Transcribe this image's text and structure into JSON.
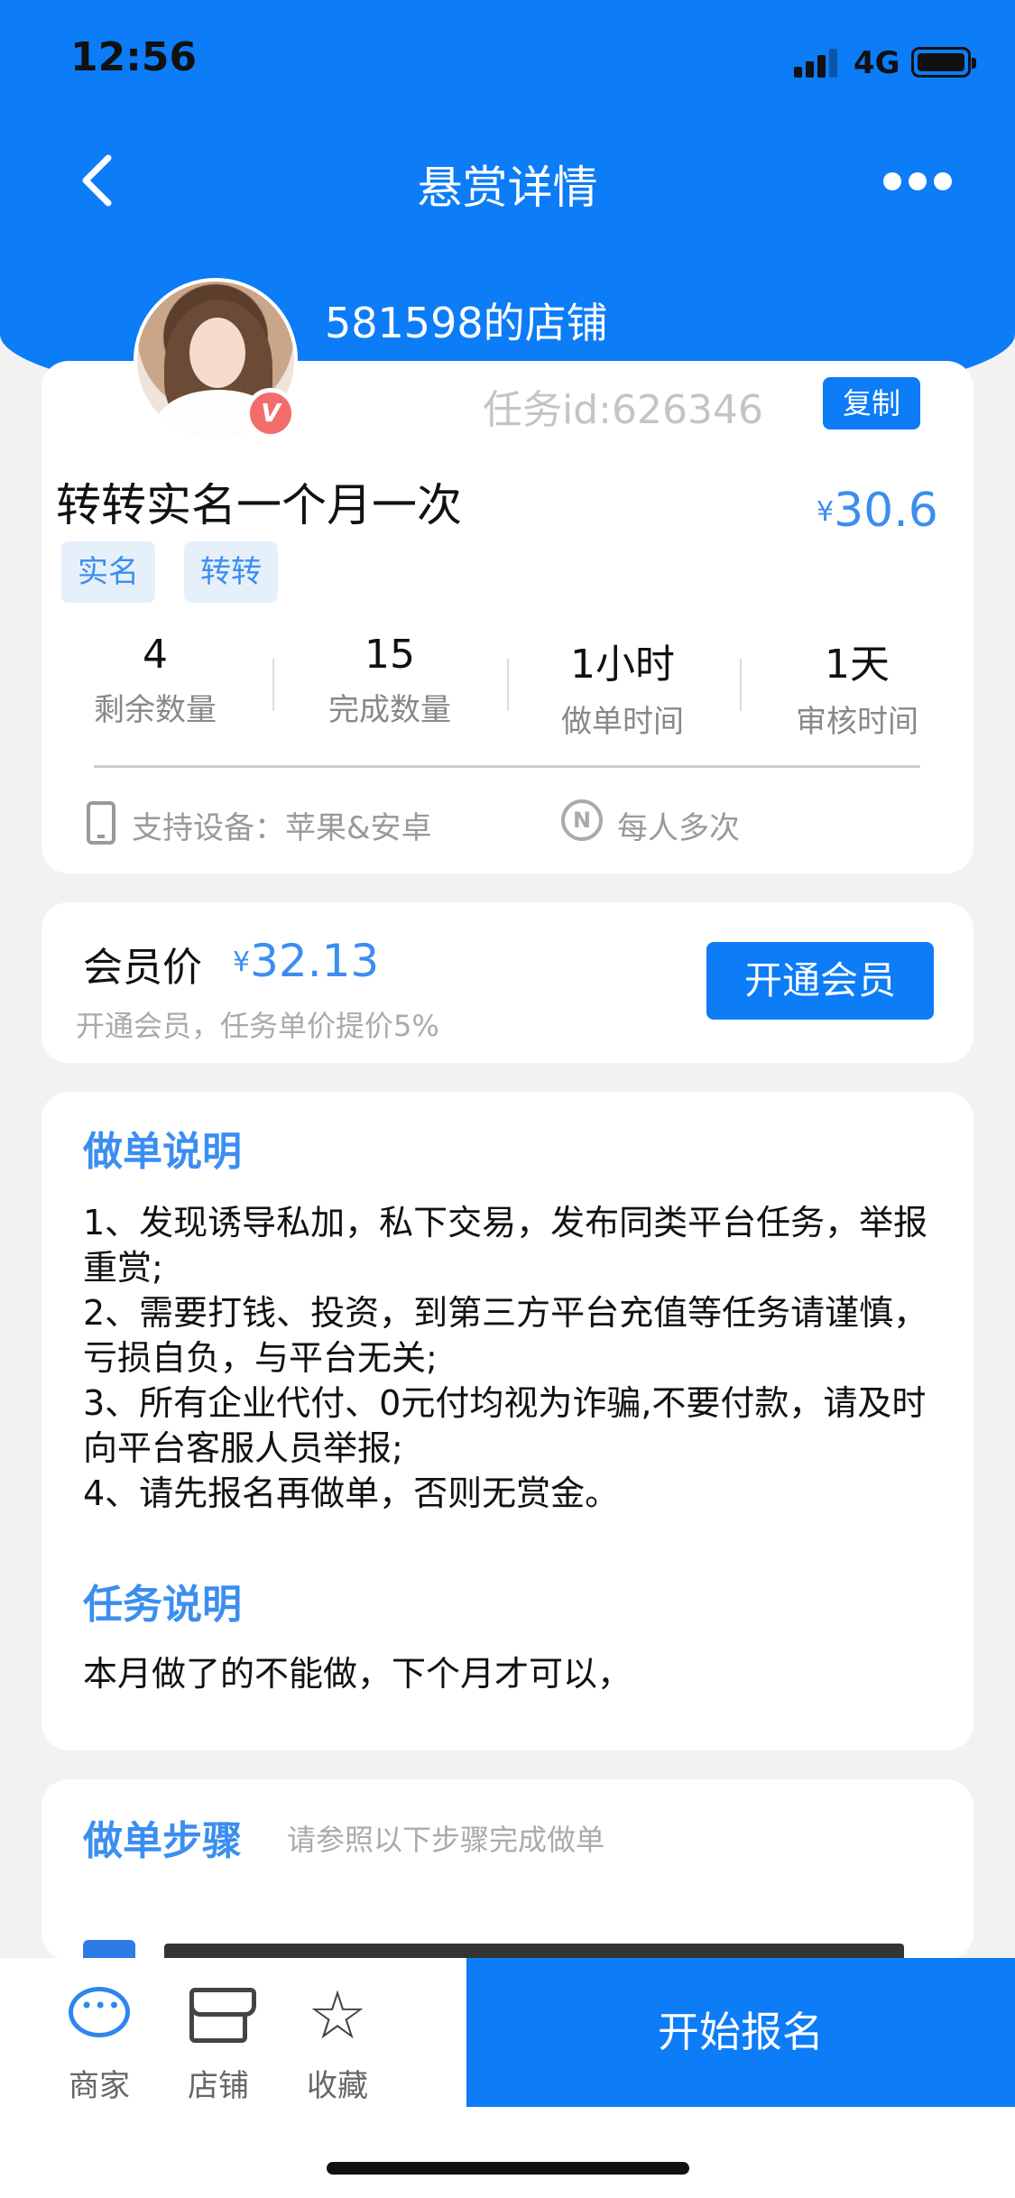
{
  "status": {
    "time": "12:56",
    "network": "4G"
  },
  "nav": {
    "title": "悬赏详情"
  },
  "shop": {
    "name": "581598的店铺",
    "vip_badge": "V"
  },
  "task": {
    "id_text": "任务id:626346",
    "copy_label": "复制",
    "title": "转转实名一个月一次",
    "price_symbol": "¥",
    "price": "30.6",
    "tags": [
      "实名",
      "转转"
    ],
    "stats": [
      {
        "value": "4",
        "label": "剩余数量"
      },
      {
        "value": "15",
        "label": "完成数量"
      },
      {
        "value": "1小时",
        "label": "做单时间"
      },
      {
        "value": "1天",
        "label": "审核时间"
      }
    ],
    "device_text": "支持设备：苹果&安卓",
    "repeat_icon": "N",
    "repeat_text": "每人多次"
  },
  "member": {
    "label": "会员价",
    "price_symbol": "¥",
    "price": "32.13",
    "note": "开通会员，任务单价提价5%",
    "button": "开通会员"
  },
  "instructions": {
    "title": "做单说明",
    "items": [
      "1、发现诱导私加，私下交易，发布同类平台任务，举报重赏;",
      "2、需要打钱、投资，到第三方平台充值等任务请谨慎，亏损自负，与平台无关;",
      "3、所有企业代付、0元付均视为诈骗,不要付款，请及时向平台客服人员举报;",
      "4、请先报名再做单，否则无赏金。"
    ]
  },
  "task_desc": {
    "title": "任务说明",
    "text": "本月做了的不能做，下个月才可以，"
  },
  "steps": {
    "title": "做单步骤",
    "hint": "请参照以下步骤完成做单"
  },
  "tabbar": {
    "items": [
      {
        "label": "商家",
        "icon": "chat-icon"
      },
      {
        "label": "店铺",
        "icon": "store-icon"
      },
      {
        "label": "收藏",
        "icon": "star-icon"
      }
    ],
    "star_glyph": "☆",
    "start_button": "开始报名"
  },
  "colors": {
    "primary": "#0c7cf7",
    "accent_text": "#3b8ef0"
  }
}
